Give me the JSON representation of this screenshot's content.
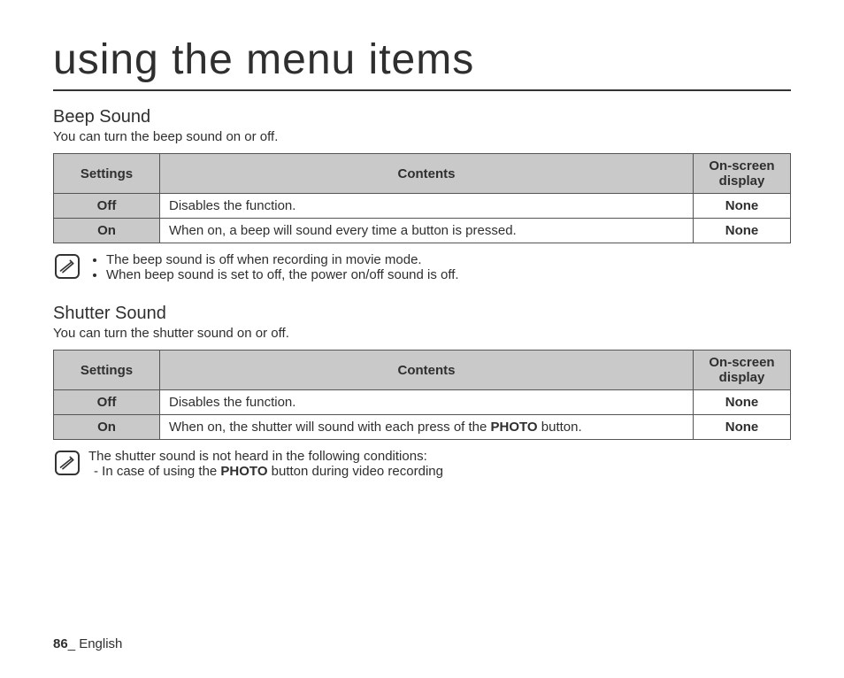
{
  "title": "using the menu items",
  "section1": {
    "heading": "Beep Sound",
    "desc": "You can turn the beep sound on or off.",
    "headers": {
      "settings": "Settings",
      "contents": "Contents",
      "display": "On-screen display"
    },
    "rows": [
      {
        "setting": "Off",
        "content": "Disables the function.",
        "display": "None"
      },
      {
        "setting": "On",
        "content": "When on, a beep will sound every time a button is pressed.",
        "display": "None"
      }
    ],
    "notes": [
      "The beep sound is off when recording in movie mode.",
      "When beep sound is set to off, the power on/off sound is off."
    ]
  },
  "section2": {
    "heading": "Shutter Sound",
    "desc": "You can turn the shutter sound on or off.",
    "headers": {
      "settings": "Settings",
      "contents": "Contents",
      "display": "On-screen display"
    },
    "rows": [
      {
        "setting": "Off",
        "content": "Disables the function.",
        "display": "None"
      },
      {
        "setting": "On",
        "content_prefix": "When on, the shutter will sound with each press of the ",
        "content_bold": "PHOTO",
        "content_suffix": " button.",
        "display": "None"
      }
    ],
    "note_intro": "The shutter sound is not heard in the following conditions:",
    "note_item_prefix": "-   In case of using the ",
    "note_item_bold": "PHOTO",
    "note_item_suffix": " button during video recording"
  },
  "footer": {
    "pagenum": "86",
    "sep": "_ ",
    "lang": "English"
  }
}
